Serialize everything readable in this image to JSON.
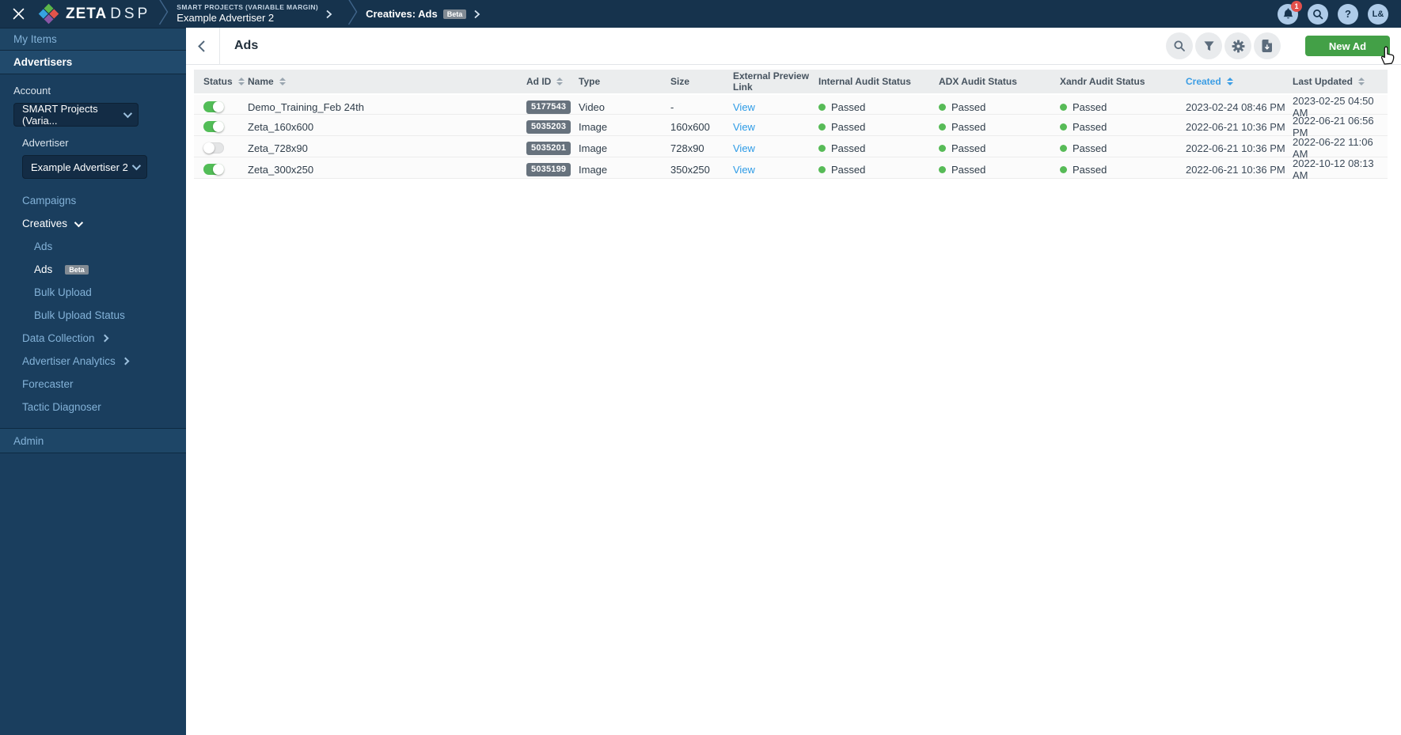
{
  "topbar": {
    "brand_bold": "ZETA",
    "brand_light": "DSP",
    "breadcrumb": {
      "account": "SMART PROJECTS (VARIABLE MARGIN)",
      "advertiser": "Example Advertiser 2",
      "page": "Creatives: Ads",
      "badge": "Beta"
    },
    "notification_count": "1",
    "help_label": "?",
    "avatar_initials": "L&"
  },
  "sidebar": {
    "my_items": "My Items",
    "advertisers": "Advertisers",
    "account": {
      "label": "Account",
      "value": "SMART Projects (Varia..."
    },
    "advertiser": {
      "label": "Advertiser",
      "value": "Example Advertiser 2"
    },
    "nav": [
      {
        "label": "Campaigns",
        "level": 0,
        "active": false
      },
      {
        "label": "Creatives",
        "level": 0,
        "active": true,
        "chevron": "down"
      },
      {
        "label": "Ads",
        "level": 1,
        "active": false
      },
      {
        "label": "Ads",
        "level": 1,
        "active": true,
        "badge": "Beta"
      },
      {
        "label": "Bulk Upload",
        "level": 1,
        "active": false
      },
      {
        "label": "Bulk Upload Status",
        "level": 1,
        "active": false
      },
      {
        "label": "Data Collection",
        "level": 0,
        "active": false,
        "chevron": "right"
      },
      {
        "label": "Advertiser Analytics",
        "level": 0,
        "active": false,
        "chevron": "right"
      },
      {
        "label": "Forecaster",
        "level": 0,
        "active": false
      },
      {
        "label": "Tactic Diagnoser",
        "level": 0,
        "active": false
      }
    ],
    "admin": "Admin"
  },
  "page": {
    "title": "Ads",
    "new_ad_label": "New Ad"
  },
  "table": {
    "columns": [
      {
        "label": "Status",
        "sort": true,
        "active": false
      },
      {
        "label": "Name",
        "sort": true,
        "active": false
      },
      {
        "label": "Ad ID",
        "sort": true,
        "active": false
      },
      {
        "label": "Type",
        "sort": false,
        "active": false
      },
      {
        "label": "Size",
        "sort": false,
        "active": false
      },
      {
        "label": "External Preview Link",
        "sort": false,
        "active": false
      },
      {
        "label": "Internal Audit Status",
        "sort": false,
        "active": false
      },
      {
        "label": "ADX Audit Status",
        "sort": false,
        "active": false
      },
      {
        "label": "Xandr Audit Status",
        "sort": false,
        "active": false
      },
      {
        "label": "Created",
        "sort": true,
        "active": true
      },
      {
        "label": "Last Updated",
        "sort": true,
        "active": false
      }
    ],
    "rows": [
      {
        "enabled": true,
        "name": "Demo_Training_Feb 24th",
        "ad_id": "5177543",
        "type": "Video",
        "size": "-",
        "preview": "View",
        "internal_audit": "Passed",
        "adx_audit": "Passed",
        "xandr_audit": "Passed",
        "created": "2023-02-24 08:46 PM",
        "last_updated": "2023-02-25 04:50 AM"
      },
      {
        "enabled": true,
        "name": "Zeta_160x600",
        "ad_id": "5035203",
        "type": "Image",
        "size": "160x600",
        "preview": "View",
        "internal_audit": "Passed",
        "adx_audit": "Passed",
        "xandr_audit": "Passed",
        "created": "2022-06-21 10:36 PM",
        "last_updated": "2022-06-21 06:56 PM"
      },
      {
        "enabled": false,
        "name": "Zeta_728x90",
        "ad_id": "5035201",
        "type": "Image",
        "size": "728x90",
        "preview": "View",
        "internal_audit": "Passed",
        "adx_audit": "Passed",
        "xandr_audit": "Passed",
        "created": "2022-06-21 10:36 PM",
        "last_updated": "2022-06-22 11:06 AM"
      },
      {
        "enabled": true,
        "name": "Zeta_300x250",
        "ad_id": "5035199",
        "type": "Image",
        "size": "350x250",
        "preview": "View",
        "internal_audit": "Passed",
        "adx_audit": "Passed",
        "xandr_audit": "Passed",
        "created": "2022-06-21 10:36 PM",
        "last_updated": "2022-10-12 08:13 AM"
      }
    ]
  },
  "colors": {
    "topbar": "#16334d",
    "sidebar": "#1a3e5e",
    "accent_green": "#43a047",
    "link_blue": "#2e9be6",
    "status_green": "#57bb57",
    "sorted_header_blue": "#3b9de4"
  }
}
